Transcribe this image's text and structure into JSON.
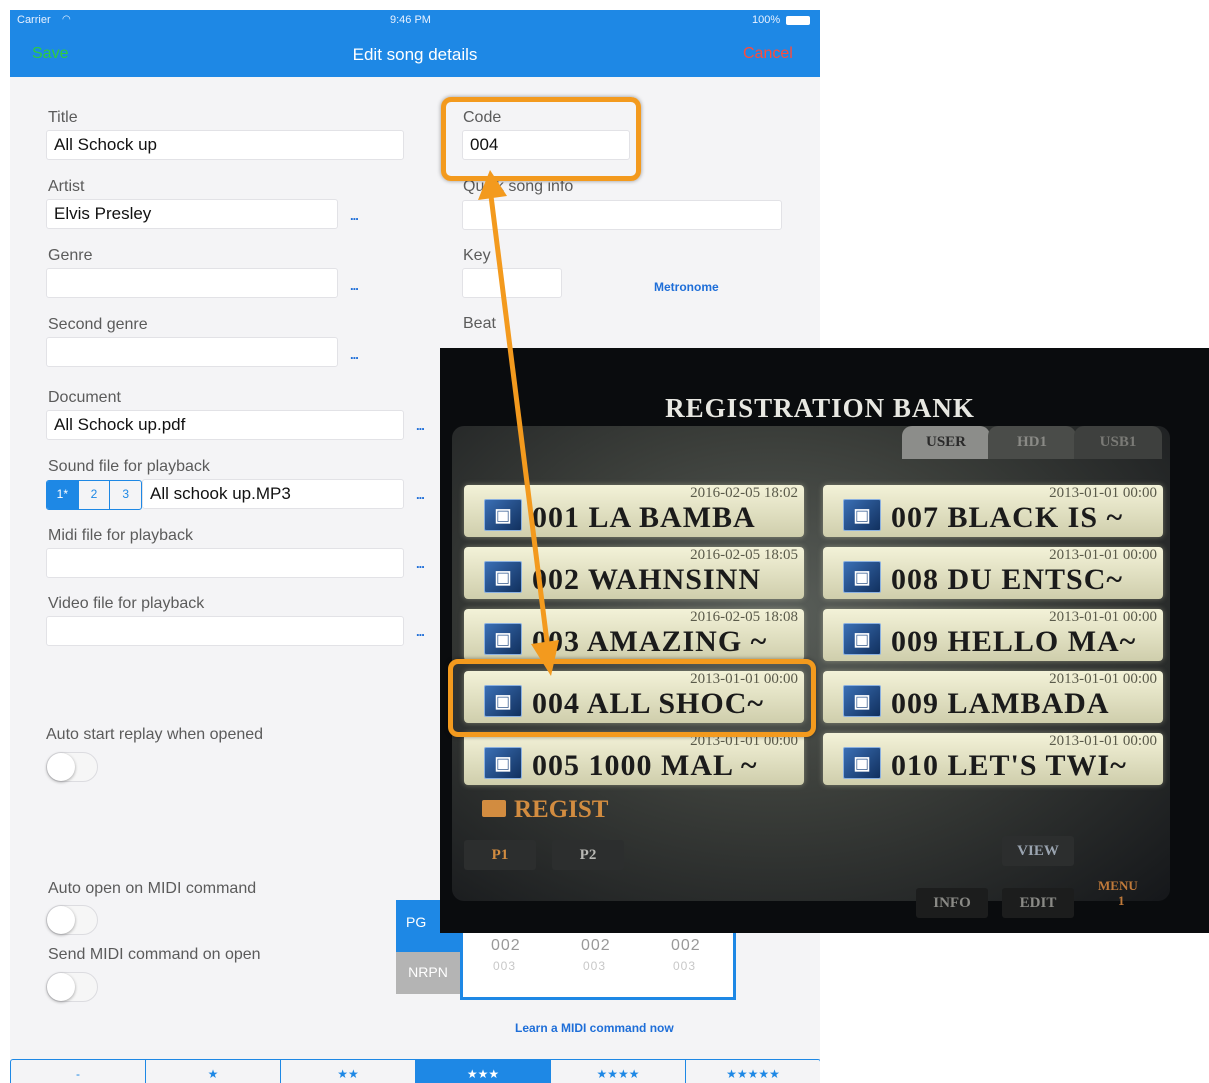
{
  "status": {
    "carrier": "Carrier",
    "time": "9:46 PM",
    "battery": "100%"
  },
  "nav": {
    "save": "Save",
    "title": "Edit song details",
    "cancel": "Cancel"
  },
  "colors": {
    "nav_blue": "#1e88e5",
    "highlight_orange": "#f39a1e",
    "save_green": "#2ecc40",
    "cancel_red": "#ff4b3a"
  },
  "form": {
    "title_label": "Title",
    "title_value": "All Schock up",
    "artist_label": "Artist",
    "artist_value": "Elvis Presley",
    "genre_label": "Genre",
    "genre_value": "",
    "second_genre_label": "Second genre",
    "second_genre_value": "",
    "document_label": "Document",
    "document_value": "All Schock up.pdf",
    "sound_label": "Sound file for playback",
    "sound_value": "All schook up.MP3",
    "sound_tabs": [
      "1*",
      "2",
      "3"
    ],
    "midi_label": "Midi file for playback",
    "midi_value": "",
    "video_label": "Video file for playback",
    "video_value": "",
    "dots": "...",
    "code_label": "Code",
    "code_value": "004",
    "quick_label": "Quick song info",
    "quick_value": "",
    "key_label": "Key",
    "beat_label": "Beat",
    "metronome": "Metronome",
    "auto_replay_label": "Auto start replay when opened",
    "auto_midi_label": "Auto open on MIDI command",
    "send_midi_label": "Send MIDI command on open",
    "learn_midi": "Learn a MIDI command now",
    "midi_modes": [
      "PG",
      "NRPN"
    ],
    "midi_values_row1": [
      "002",
      "002",
      "002"
    ],
    "midi_values_row2": [
      "003",
      "003",
      "003"
    ],
    "rating": [
      "-",
      "★",
      "★★",
      "★★★",
      "★★★★",
      "★★★★★"
    ],
    "rating_selected": 3
  },
  "photo": {
    "title": "REGISTRATION BANK",
    "tabs": [
      "USER",
      "HD1",
      "USB1"
    ],
    "slots_left": [
      {
        "name": "001 LA BAMBA",
        "date": "2016-02-05 18:02"
      },
      {
        "name": "002 WAHNSINN",
        "date": "2016-02-05 18:05"
      },
      {
        "name": "003 AMAZING ~",
        "date": "2016-02-05 18:08"
      },
      {
        "name": "004 ALL SHOC~",
        "date": "2013-01-01 00:00"
      },
      {
        "name": "005 1000 MAL ~",
        "date": "2013-01-01 00:00"
      }
    ],
    "slots_right": [
      {
        "name": "007 BLACK IS ~",
        "date": "2013-01-01 00:00"
      },
      {
        "name": "008 DU ENTSC~",
        "date": "2013-01-01 00:00"
      },
      {
        "name": "009 HELLO MA~",
        "date": "2013-01-01 00:00"
      },
      {
        "name": "009 LAMBADA",
        "date": "2013-01-01 00:00"
      },
      {
        "name": "010 LET'S TWI~",
        "date": "2013-01-01 00:00"
      }
    ],
    "folder": "REGIST",
    "page_buttons": [
      "P1",
      "P2"
    ],
    "view": "VIEW",
    "info": "INFO",
    "edit": "EDIT",
    "menu": "MENU",
    "menu_num": "1"
  }
}
